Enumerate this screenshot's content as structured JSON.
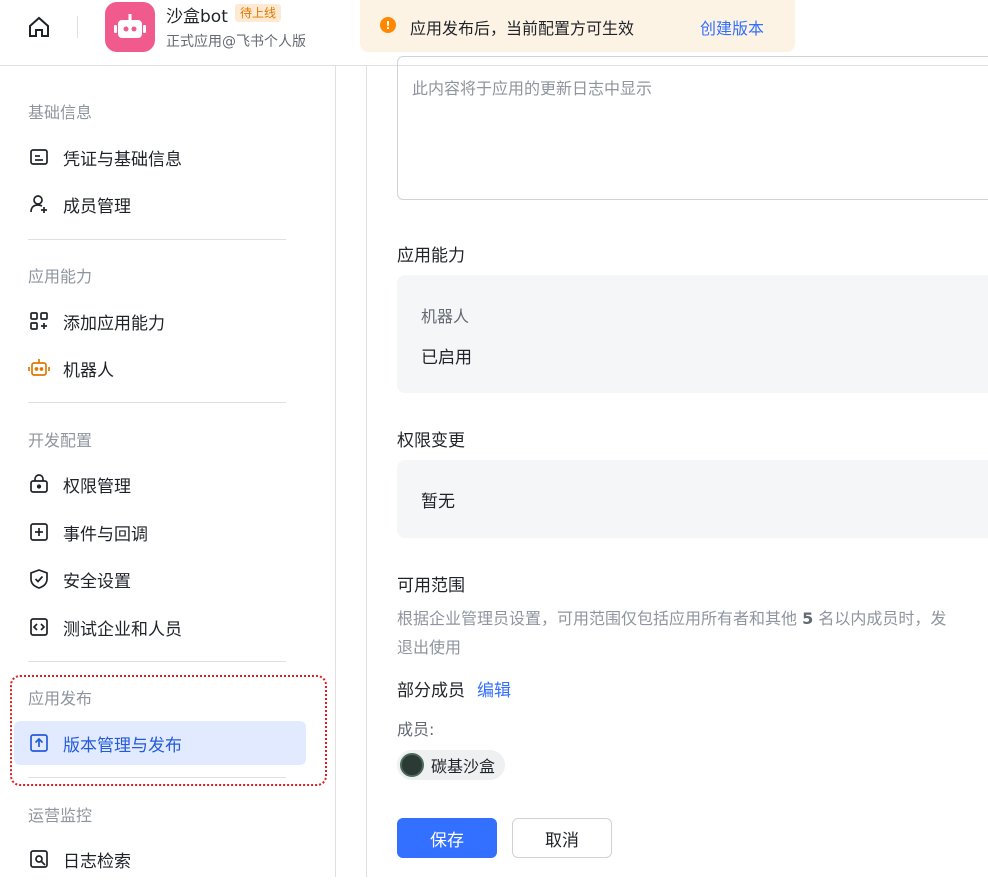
{
  "header": {
    "app_name": "沙盒bot",
    "app_status": "待上线",
    "app_subtitle": "正式应用@飞书个人版"
  },
  "notice": {
    "text": "应用发布后，当前配置方可生效",
    "link": "创建版本"
  },
  "sidebar": {
    "sections": [
      {
        "title": "基础信息",
        "items": [
          "凭证与基础信息",
          "成员管理"
        ]
      },
      {
        "title": "应用能力",
        "items": [
          "添加应用能力",
          "机器人"
        ]
      },
      {
        "title": "开发配置",
        "items": [
          "权限管理",
          "事件与回调",
          "安全设置",
          "测试企业和人员"
        ]
      },
      {
        "title": "应用发布",
        "items": [
          "版本管理与发布"
        ]
      },
      {
        "title": "运营监控",
        "items": [
          "日志检索"
        ]
      }
    ],
    "active_item": "版本管理与发布"
  },
  "main": {
    "changelog_placeholder": "此内容将于应用的更新日志中显示",
    "capability": {
      "title": "应用能力",
      "name": "机器人",
      "status": "已启用"
    },
    "permission": {
      "title": "权限变更",
      "value": "暂无"
    },
    "scope": {
      "title": "可用范围",
      "desc_prefix": "根据企业管理员设置，可用范围仅包括应用所有者和其他",
      "desc_num": "5",
      "desc_suffix": "名以内成员时，发",
      "desc_line2": "退出使用",
      "mode": "部分成员",
      "edit": "编辑",
      "members_label": "成员:",
      "member_name": "碳基沙盒"
    },
    "save": "保存",
    "cancel": "取消"
  },
  "colors": {
    "accent": "#3370ff",
    "active_bg": "#e1eaff",
    "notice_bg": "#fdf3e5",
    "warning": "#ff8800",
    "logo": "#f05a8c"
  }
}
